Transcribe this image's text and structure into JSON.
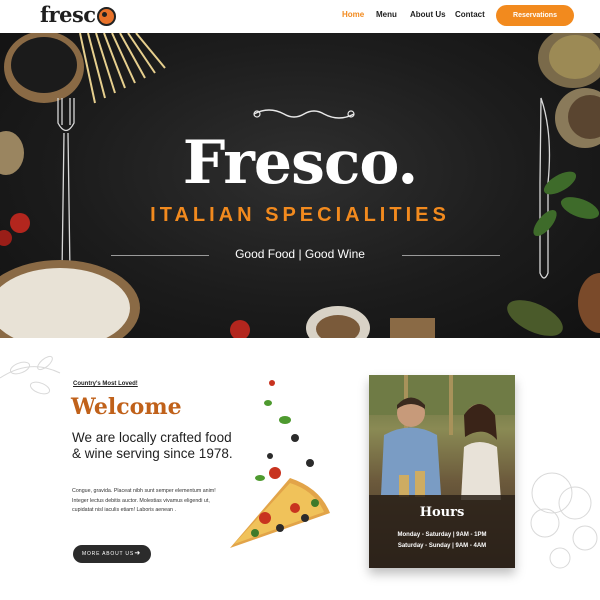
{
  "brand": {
    "logo_text": "fresc"
  },
  "nav": {
    "items": [
      {
        "label": "Home",
        "active": true
      },
      {
        "label": "Menu",
        "active": false
      },
      {
        "label": "About Us",
        "active": false
      },
      {
        "label": "Contact",
        "active": false
      }
    ],
    "cta": "Reservations"
  },
  "hero": {
    "title": "Fresco.",
    "subtitle": "ITALIAN SPECIALITIES",
    "tagline": "Good Food | Good Wine"
  },
  "intro": {
    "kicker": "Country's Most Loved!",
    "heading": "Welcome",
    "lead": "We are locally crafted food & wine serving since 1978.",
    "body": "Congue, gravida. Placeat nibh sunt semper elementum anim! Integer lectus debitis auctor. Molestias vivamus eligendi ut, cupidatat nisl iaculis etiam! Laboris aenean .",
    "button": "MORE ABOUT US"
  },
  "hours": {
    "title": "Hours",
    "weekday": "Monday - Saturday | 9AM - 1PM",
    "weekend": "Saturday - Sunday | 9AM - 4AM"
  },
  "colors": {
    "accent": "#f28a1e",
    "heading_brown": "#c0611a",
    "hero_bg": "#1c1c1c",
    "dark_button": "#2b2b2b"
  },
  "icons": [
    "pizza-logo-icon",
    "arrow-right-icon",
    "flourish-ornament-icon"
  ]
}
